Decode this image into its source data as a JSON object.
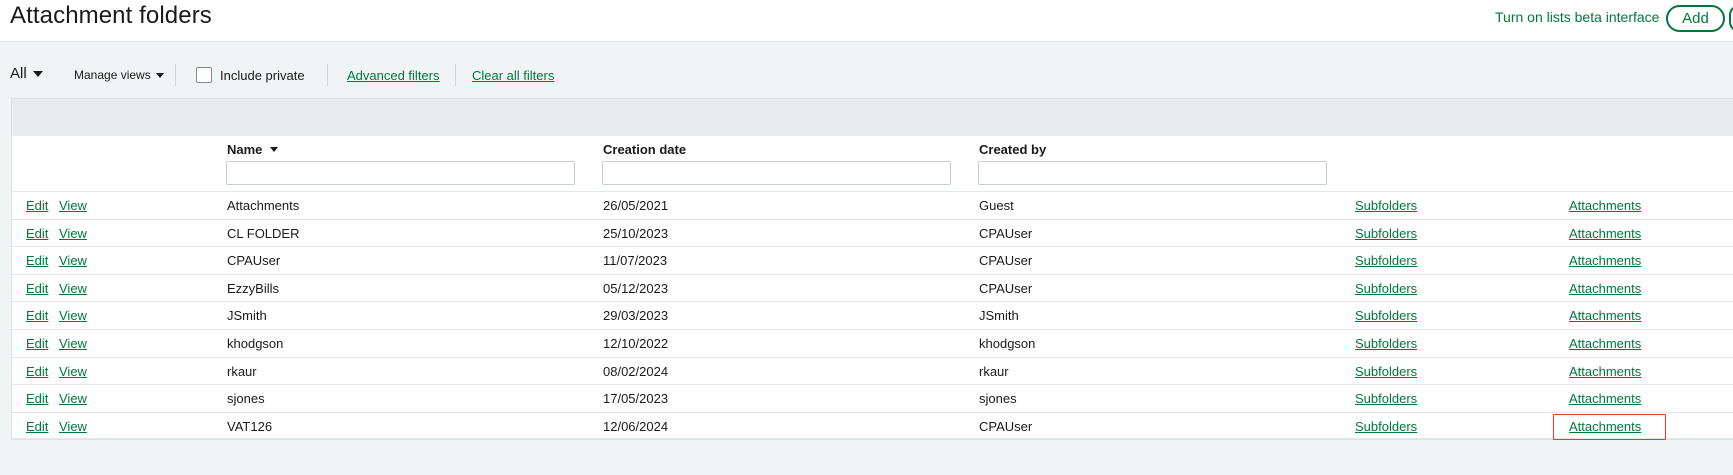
{
  "header": {
    "title": "Attachment folders",
    "beta_link": "Turn on lists beta interface",
    "add_label": "Add"
  },
  "filters": {
    "view": "All",
    "manage_views": "Manage views",
    "include_private": "Include private",
    "include_private_checked": false,
    "advanced_filters": "Advanced filters",
    "clear_all_filters": "Clear all filters"
  },
  "table": {
    "columns": {
      "name": "Name",
      "creation_date": "Creation date",
      "created_by": "Created by"
    },
    "sort_column": "name",
    "edit_label": "Edit",
    "view_label": "View",
    "subfolders_label": "Subfolders",
    "attachments_label": "Attachments",
    "rows": [
      {
        "name": "Attachments",
        "creation_date": "26/05/2021",
        "created_by": "Guest"
      },
      {
        "name": "CL FOLDER",
        "creation_date": "25/10/2023",
        "created_by": "CPAUser"
      },
      {
        "name": "CPAUser",
        "creation_date": "11/07/2023",
        "created_by": "CPAUser"
      },
      {
        "name": "EzzyBills",
        "creation_date": "05/12/2023",
        "created_by": "CPAUser"
      },
      {
        "name": "JSmith",
        "creation_date": "29/03/2023",
        "created_by": "JSmith"
      },
      {
        "name": "khodgson",
        "creation_date": "12/10/2022",
        "created_by": "khodgson"
      },
      {
        "name": "rkaur",
        "creation_date": "08/02/2024",
        "created_by": "rkaur"
      },
      {
        "name": "sjones",
        "creation_date": "17/05/2023",
        "created_by": "sjones"
      },
      {
        "name": "VAT126",
        "creation_date": "12/06/2024",
        "created_by": "CPAUser"
      }
    ]
  },
  "colors": {
    "accent": "#00783c",
    "highlight": "#e53935"
  }
}
